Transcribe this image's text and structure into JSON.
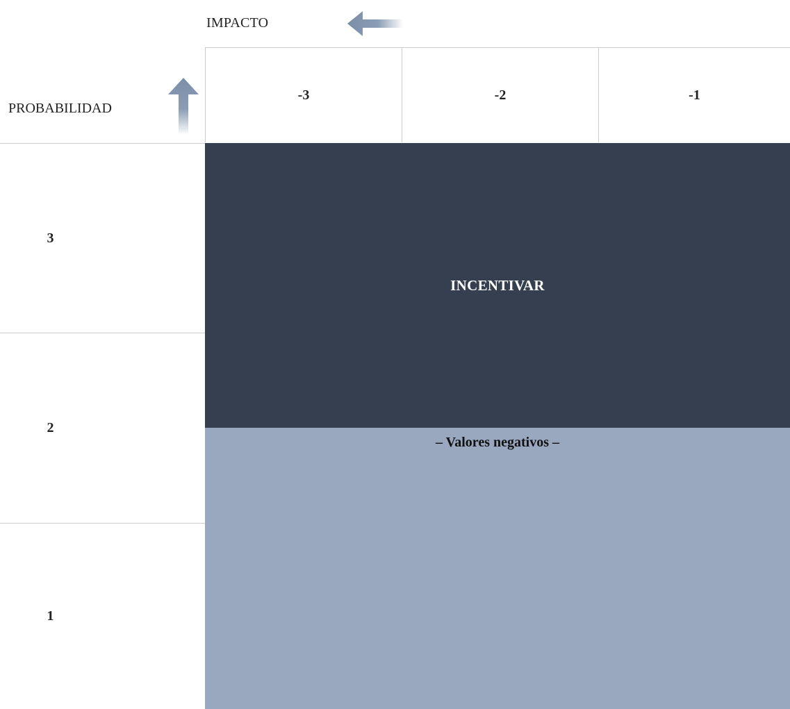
{
  "axes": {
    "impact_label": "IMPACTO",
    "probability_label": "PROBABILIDAD"
  },
  "columns": [
    "-3",
    "-2",
    "-1"
  ],
  "rows": [
    "3",
    "2",
    "1"
  ],
  "zones": {
    "dark": {
      "label": "INCENTIVAR",
      "color": "#353f4f"
    },
    "light": {
      "label": "– Valores negativos –",
      "color": "#99a8be"
    }
  },
  "colors": {
    "arrow": "#7b8ea8",
    "grid_line": "#cccccc"
  },
  "icons": {
    "impact_arrow": "arrow-left-icon",
    "probability_arrow": "arrow-up-icon"
  }
}
